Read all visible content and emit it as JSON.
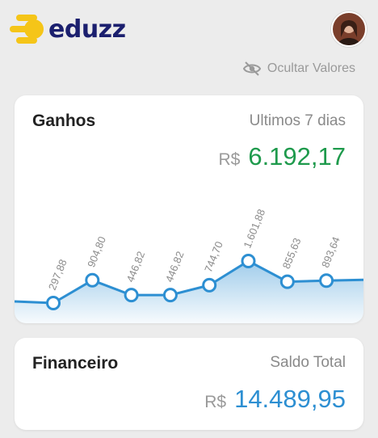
{
  "brand": {
    "name": "eduzz"
  },
  "hide_values": {
    "label": "Ocultar Valores"
  },
  "earnings": {
    "title": "Ganhos",
    "period": "Ultimos 7 dias",
    "currency": "R$",
    "total": "6.192,17",
    "total_color": "#1e9a4c"
  },
  "finance": {
    "title": "Financeiro",
    "subtitle": "Saldo Total",
    "currency": "R$",
    "total": "14.489,95",
    "total_color": "#2d8fd2"
  },
  "chart_data": {
    "type": "area",
    "labels": [
      "297,88",
      "904,80",
      "446,82",
      "446,82",
      "744,70",
      "1.601,88",
      "855,63",
      "893,64"
    ],
    "values": [
      297.88,
      904.8,
      446.82,
      446.82,
      744.7,
      1601.88,
      855.63,
      893.64
    ],
    "line_color": "#2d8fd2"
  }
}
